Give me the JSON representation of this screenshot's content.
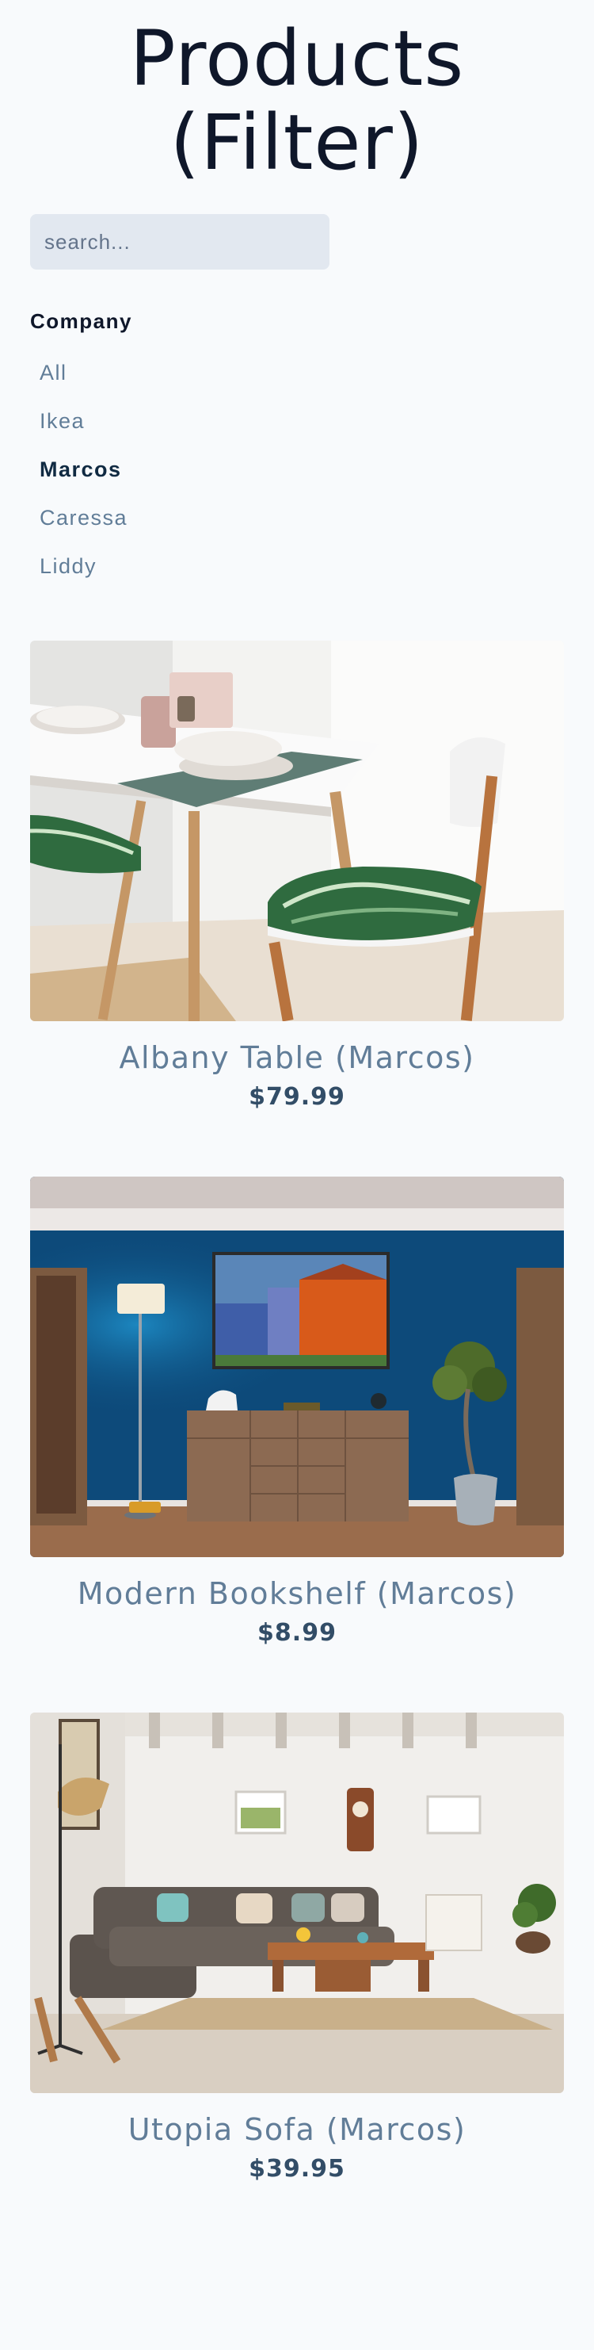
{
  "header": {
    "title": "Products (Filter)"
  },
  "filters": {
    "search_placeholder": "search...",
    "company_heading": "Company",
    "companies": [
      "All",
      "Ikea",
      "Marcos",
      "Caressa",
      "Liddy"
    ],
    "active_company": "Marcos"
  },
  "products": [
    {
      "name": "Albany Table (Marcos)",
      "price": "$79.99",
      "image": "dining-table-photo"
    },
    {
      "name": "Modern Bookshelf (Marcos)",
      "price": "$8.99",
      "image": "living-room-blue-wall-photo"
    },
    {
      "name": "Utopia Sofa (Marcos)",
      "price": "$39.95",
      "image": "sofa-living-room-photo"
    }
  ]
}
